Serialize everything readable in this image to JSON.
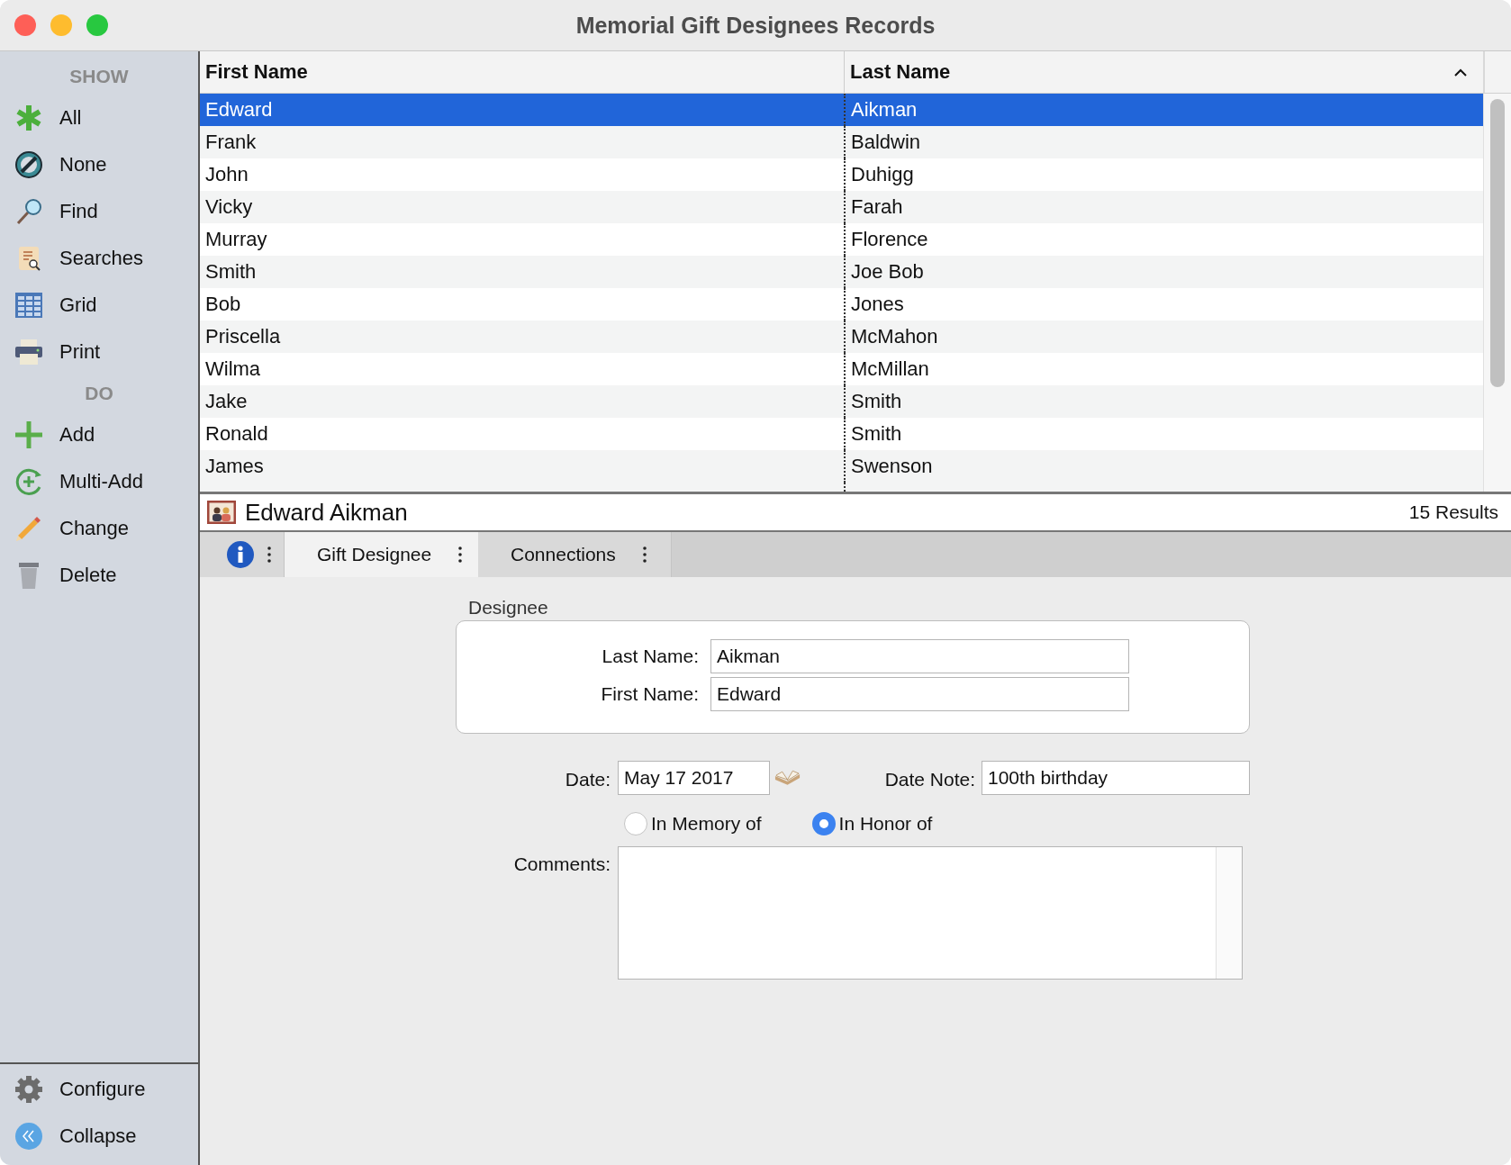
{
  "window": {
    "title": "Memorial Gift Designees Records"
  },
  "sidebar": {
    "sections": [
      {
        "heading": "SHOW",
        "items": [
          {
            "label": "All",
            "kind": "all"
          },
          {
            "label": "None",
            "kind": "none"
          },
          {
            "label": "Find",
            "kind": "find"
          },
          {
            "label": "Searches",
            "kind": "searches"
          },
          {
            "label": "Grid",
            "kind": "grid"
          },
          {
            "label": "Print",
            "kind": "print"
          }
        ]
      },
      {
        "heading": "DO",
        "items": [
          {
            "label": "Add",
            "kind": "add"
          },
          {
            "label": "Multi-Add",
            "kind": "multiadd"
          },
          {
            "label": "Change",
            "kind": "change"
          },
          {
            "label": "Delete",
            "kind": "delete"
          }
        ]
      }
    ],
    "footer": [
      {
        "label": "Configure",
        "kind": "configure"
      },
      {
        "label": "Collapse",
        "kind": "collapse"
      }
    ]
  },
  "table": {
    "columns": [
      {
        "label": "First Name",
        "sorted": false
      },
      {
        "label": "Last Name",
        "sorted": true
      }
    ],
    "rows": [
      {
        "first_name": "Edward",
        "last_name": "Aikman",
        "selected": true
      },
      {
        "first_name": "Frank",
        "last_name": "Baldwin",
        "selected": false
      },
      {
        "first_name": "John",
        "last_name": "Duhigg",
        "selected": false
      },
      {
        "first_name": "Vicky",
        "last_name": "Farah",
        "selected": false
      },
      {
        "first_name": "Murray",
        "last_name": "Florence",
        "selected": false
      },
      {
        "first_name": "Smith",
        "last_name": "Joe Bob",
        "selected": false
      },
      {
        "first_name": "Bob",
        "last_name": "Jones",
        "selected": false
      },
      {
        "first_name": "Priscella",
        "last_name": "McMahon",
        "selected": false
      },
      {
        "first_name": "Wilma",
        "last_name": "McMillan",
        "selected": false
      },
      {
        "first_name": "Jake",
        "last_name": "Smith",
        "selected": false
      },
      {
        "first_name": "Ronald",
        "last_name": "Smith",
        "selected": false
      },
      {
        "first_name": "James",
        "last_name": "Swenson",
        "selected": false
      }
    ]
  },
  "record_bar": {
    "title": "Edward Aikman",
    "results": "15 Results"
  },
  "tabs": [
    {
      "kind": "info",
      "selected": false
    },
    {
      "kind": "text",
      "label": "Gift Designee",
      "selected": true
    },
    {
      "kind": "text",
      "label": "Connections",
      "selected": false
    }
  ],
  "form": {
    "group_title": "Designee",
    "fields": [
      {
        "label": "Last Name:",
        "value": "Aikman"
      },
      {
        "label": "First Name:",
        "value": "Edward"
      }
    ],
    "date": {
      "label": "Date:",
      "value": "May 17 2017"
    },
    "date_note": {
      "label": "Date Note:",
      "value": "100th birthday"
    },
    "radios": [
      {
        "label": "In Memory of",
        "selected": false
      },
      {
        "label": "In Honor of",
        "selected": true
      }
    ],
    "comments": {
      "label": "Comments:"
    }
  }
}
